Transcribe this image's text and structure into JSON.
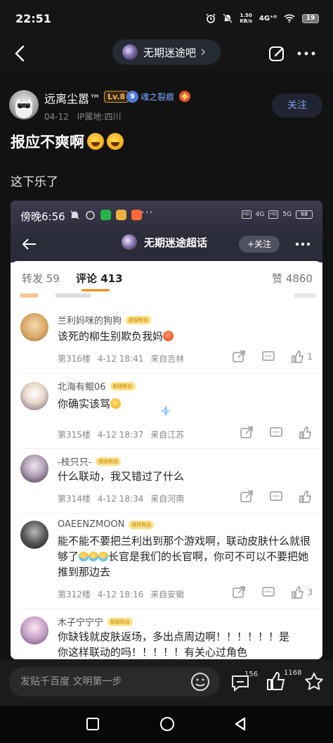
{
  "status_bar": {
    "time": "22:51",
    "net_speed": "1.50",
    "net_unit": "KB/s",
    "signal": "4G⁺ᴵᴵ",
    "battery": "19"
  },
  "nav": {
    "forum_name": "无期迷途吧"
  },
  "post": {
    "author": "远离尘嚣™",
    "level": "Lv.8",
    "fan_level": "9",
    "fan_title": "魂之裂痕",
    "date": "04-12",
    "ip_location": "IP属地:四川",
    "follow_label": "关注",
    "title": "报应不爽啊",
    "body": "这下乐了"
  },
  "screenshot": {
    "status_time": "傍晚6:56",
    "status_dots": "···",
    "status_4g": "4G",
    "status_5g": "5G",
    "status_battery": "98",
    "title": "无期迷途超话",
    "follow_label": "+关注",
    "tabs": {
      "repost": "转发 59",
      "comment": "评论 413",
      "likes": "赞 4860"
    },
    "comments": [
      {
        "user": "兰利妈咪的狗狗",
        "badge": "超级粉丝",
        "text": "该死的柳生别欺负我妈",
        "floor": "第316楼",
        "date": "4-12 18:41",
        "source": "来自吉林",
        "likes": "1"
      },
      {
        "user": "北海有鲲06",
        "badge": "超级粉丝",
        "text": "你确实该骂",
        "floor": "第315楼",
        "date": "4-12 18:37",
        "source": "来自江苏",
        "likes": ""
      },
      {
        "user": "-枝只只-",
        "badge": "超级粉丝",
        "text": "什么联动，我又错过了什么",
        "floor": "第314楼",
        "date": "4-12 18:34",
        "source": "来自河南",
        "likes": ""
      },
      {
        "user": "OAEENZMOON",
        "badge": "铁杆粉丝",
        "text_part1": "能不能不要把兰利出到那个游戏啊，联动皮肤什么就很够了",
        "text_part2": "长官是我们的长官啊，你可不可以不要把她推到那边去",
        "floor": "第312楼",
        "date": "4-12 18:16",
        "source": "来自安徽",
        "likes": "3"
      },
      {
        "user": "木子宁宁宁",
        "badge": "超级粉丝",
        "text": "你缺钱就皮肤返场，多出点周边啊！！！！！！是你这样联动的吗！！！！！有关心过角色",
        "floor": "",
        "date": "",
        "source": "",
        "likes": ""
      }
    ]
  },
  "bottom_bar": {
    "input_placeholder": "发贴千百度 文明第一步",
    "comment_count": "156",
    "like_count": "1168"
  },
  "colors": {
    "background": "#121212",
    "accent_blue": "#7da2e6",
    "level_gold": "#f0b860",
    "badge_yellow": "#fde389",
    "tab_underline": "#ff8a00"
  }
}
